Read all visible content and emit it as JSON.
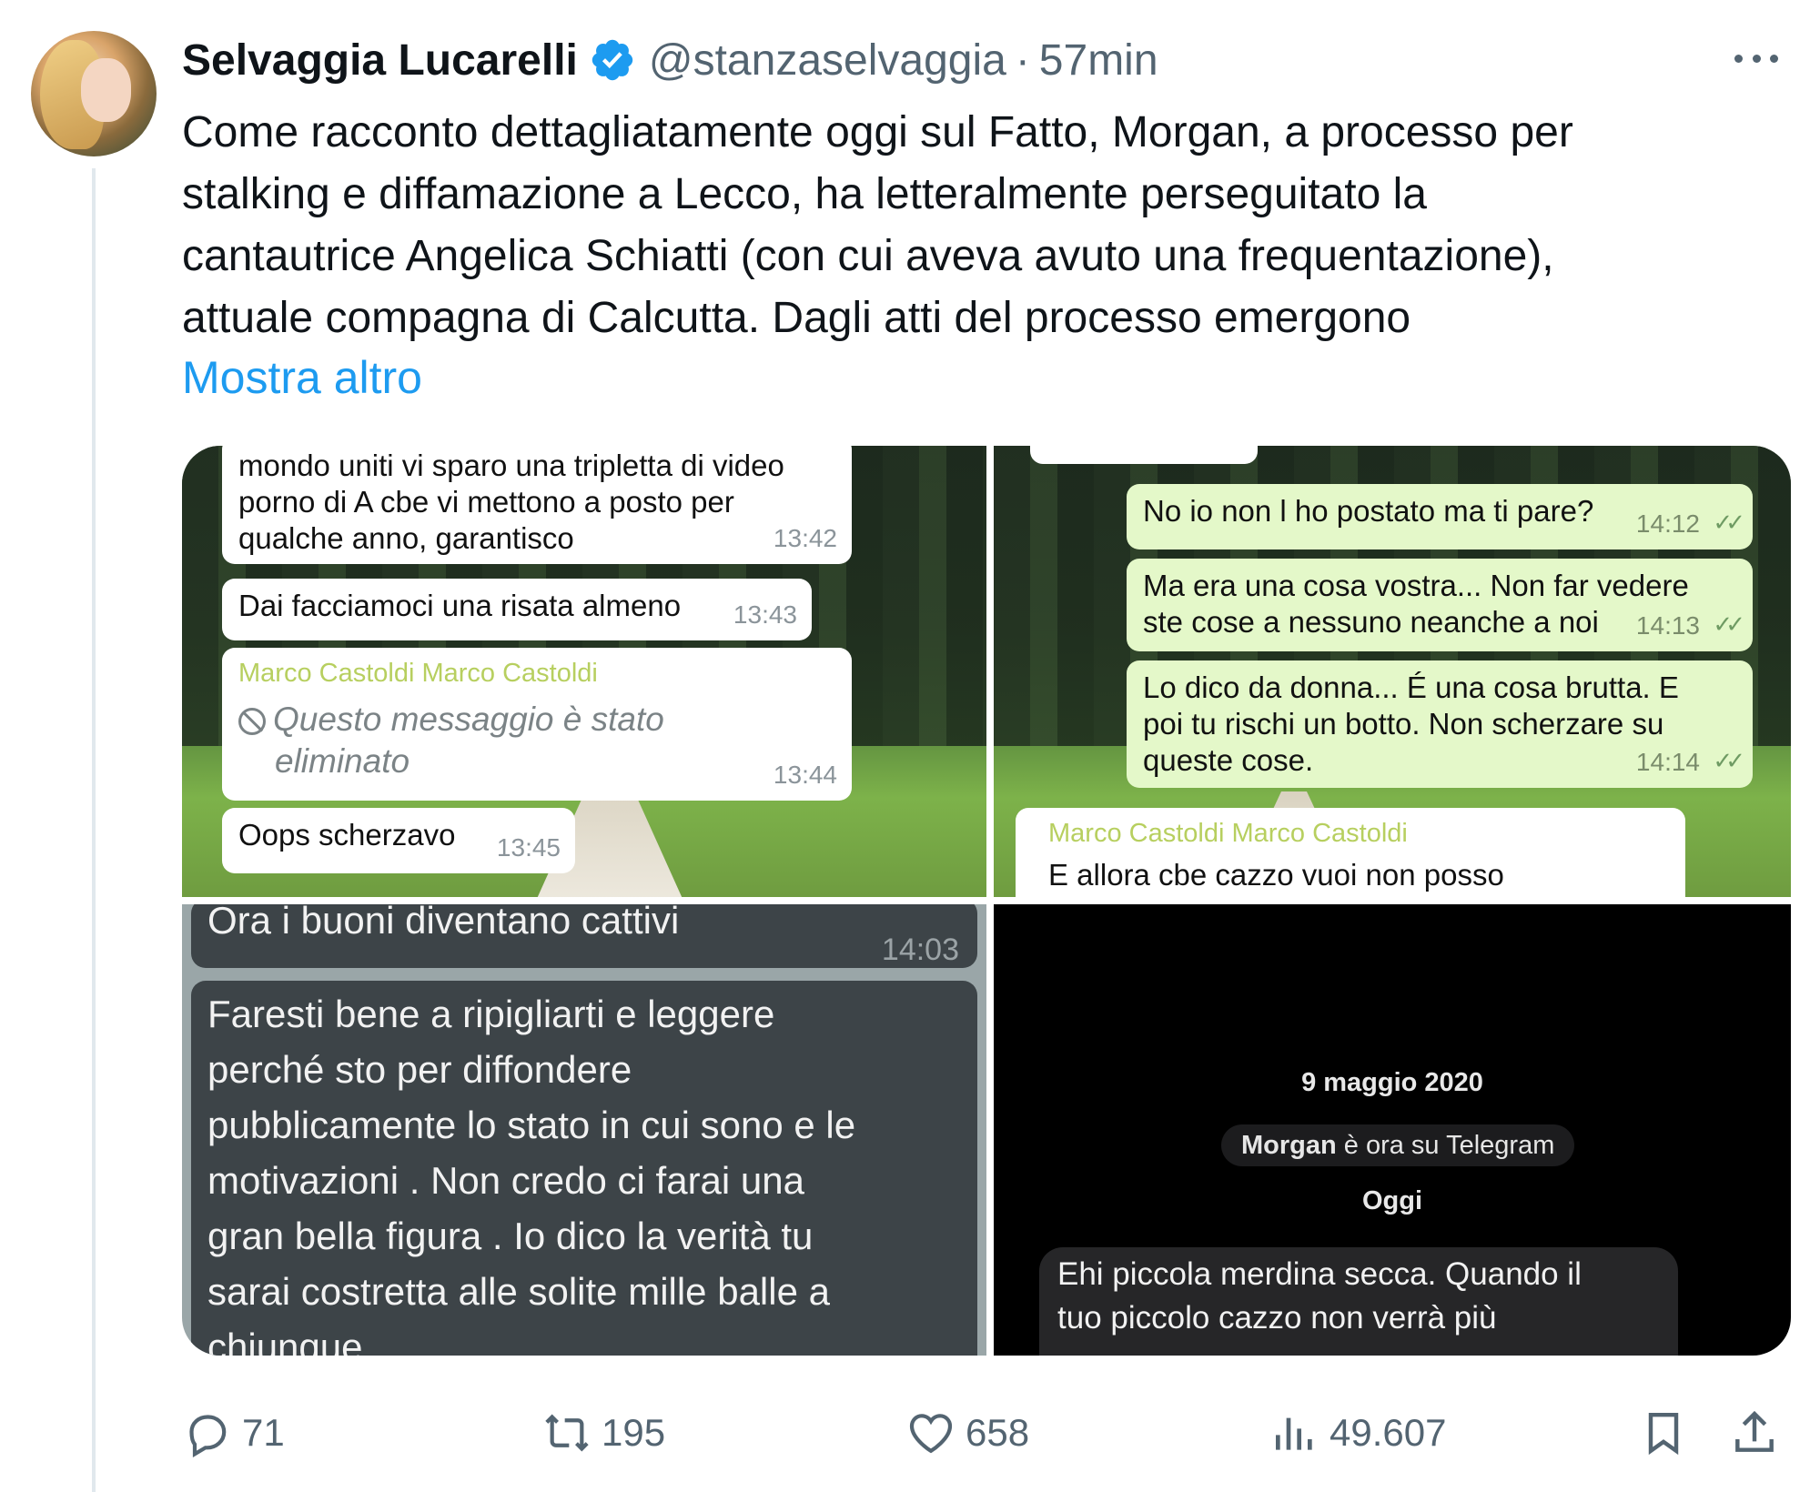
{
  "author": {
    "name": "Selvaggia Lucarelli",
    "handle": "@stanzaselvaggia",
    "separator": "·",
    "time": "57min"
  },
  "tweet": {
    "text_lines": [
      "Come racconto dettagliatamente oggi sul Fatto, Morgan, a processo per",
      "stalking e diffamazione a Lecco, ha letteralmente perseguitato la",
      "cantautrice Angelica Schiatti (con cui aveva avuto una frequentazione),",
      "attuale compagna di Calcutta. Dagli atti del processo emergono"
    ],
    "show_more": "Mostra altro"
  },
  "media": {
    "image1": {
      "messages": [
        {
          "text": "mondo uniti vi sparo una tripletta di video porno di A cbe vi mettono a posto per qualche anno, garantisco",
          "lines": [
            "mondo uniti vi sparo una tripletta di video",
            "porno di A cbe vi mettono a posto per",
            "qualche anno, garantisco"
          ],
          "time": "13:42"
        },
        {
          "text": "Dai facciamoci una risata almeno",
          "time": "13:43"
        },
        {
          "sender": "Marco Castoldi Marco Castoldi",
          "deleted_lines": [
            "Questo messaggio è stato",
            "eliminato"
          ],
          "time": "13:44"
        },
        {
          "text": "Oops scherzavo",
          "time": "13:45"
        }
      ]
    },
    "image2": {
      "messages": [
        {
          "text": "No io non l ho postato ma ti pare?",
          "time": "14:12"
        },
        {
          "lines": [
            "Ma era una cosa vostra... Non far vedere",
            "ste cose a nessuno neanche a noi"
          ],
          "time": "14:13"
        },
        {
          "lines": [
            "Lo dico da donna... É una cosa brutta. E",
            "poi tu rischi un botto. Non scherzare su",
            "queste cose."
          ],
          "time": "14:14"
        },
        {
          "sender": "Marco Castoldi Marco Castoldi",
          "text": "E allora cbe cazzo vuoi non posso"
        }
      ]
    },
    "image3": {
      "messages": [
        {
          "text": "Ora i buoni diventano cattivi",
          "time": "14:03"
        },
        {
          "lines": [
            "Faresti bene a ripigliarti e leggere",
            "perché sto per diffondere",
            "pubblicamente lo stato in cui sono e le",
            "motivazioni . Non credo ci farai una",
            "gran bella figura . Io dico la verità tu",
            "sarai costretta alle solite mille balle a",
            "chiunque"
          ]
        }
      ]
    },
    "image4": {
      "date": "9 maggio 2020",
      "service_name": "Morgan",
      "service_text": " è ora su Telegram",
      "today": "Oggi",
      "message_lines": [
        "Ehi piccola merdina secca. Quando il",
        "tuo piccolo cazzo non verrà più"
      ]
    }
  },
  "actions": {
    "replies": "71",
    "retweets": "195",
    "likes": "658",
    "views": "49.607"
  },
  "colors": {
    "text": "#0f1419",
    "secondary": "#536471",
    "link": "#1d9bf0",
    "verified": "#1d9bf0"
  }
}
